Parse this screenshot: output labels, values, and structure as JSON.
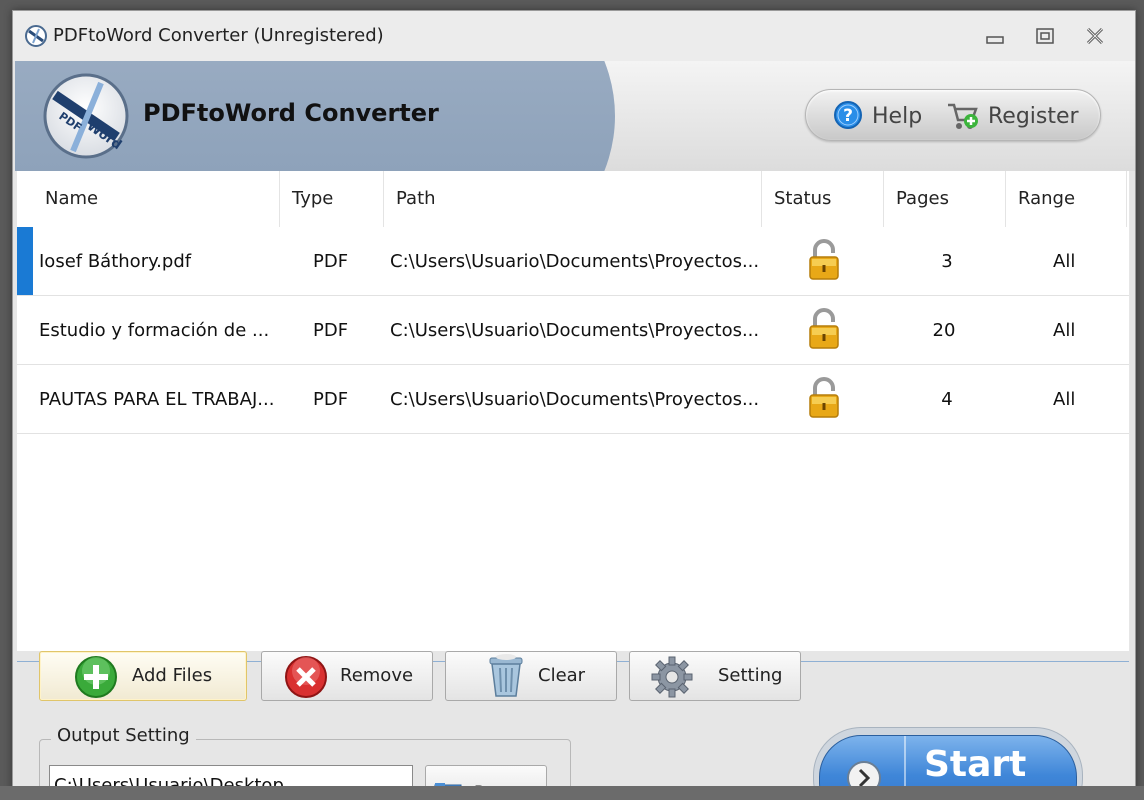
{
  "window": {
    "title": "PDFtoWord Converter (Unregistered)"
  },
  "header": {
    "brand_title": "PDFtoWord Converter",
    "logo_text_1": "PDF",
    "logo_text_2": "Word",
    "help_label": "Help",
    "register_label": "Register"
  },
  "table": {
    "columns": [
      "Name",
      "Type",
      "Path",
      "Status",
      "Pages",
      "Range"
    ],
    "rows": [
      {
        "name": "Iosef Báthory.pdf",
        "type": "PDF",
        "path": "C:\\Users\\Usuario\\Documents\\Proyectos...",
        "status_icon": "lock-icon",
        "pages": "3",
        "range": "All",
        "selected": true
      },
      {
        "name": "Estudio y formación de ...",
        "type": "PDF",
        "path": "C:\\Users\\Usuario\\Documents\\Proyectos...",
        "status_icon": "lock-icon",
        "pages": "20",
        "range": "All",
        "selected": false
      },
      {
        "name": "PAUTAS PARA EL TRABAJ...",
        "type": "PDF",
        "path": "C:\\Users\\Usuario\\Documents\\Proyectos...",
        "status_icon": "lock-icon",
        "pages": "4",
        "range": "All",
        "selected": false
      }
    ]
  },
  "toolbar": {
    "add_files_label": "Add Files",
    "remove_label": "Remove",
    "clear_label": "Clear",
    "setting_label": "Setting"
  },
  "output": {
    "legend": "Output Setting",
    "path_value": "C:\\Users\\Usuario\\Desktop",
    "browse_label": "Browse"
  },
  "start": {
    "label": "Start"
  },
  "colors": {
    "accent_blue": "#2e72c8",
    "selection_bar": "#1a7ad4",
    "lock_gold": "#e8a817"
  }
}
